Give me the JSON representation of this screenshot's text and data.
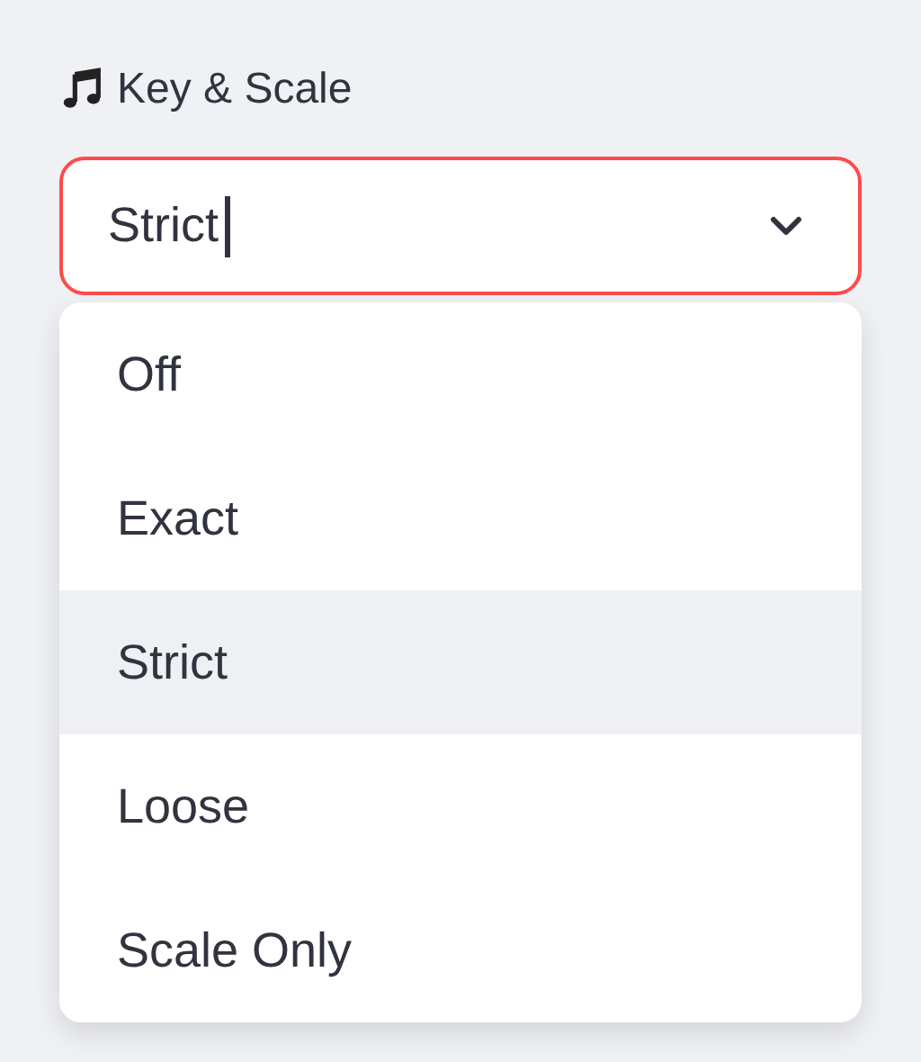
{
  "field": {
    "label": "Key & Scale",
    "value": "Strict",
    "focused": true,
    "expanded": true
  },
  "options": [
    {
      "label": "Off",
      "selected": false
    },
    {
      "label": "Exact",
      "selected": false
    },
    {
      "label": "Strict",
      "selected": true
    },
    {
      "label": "Loose",
      "selected": false
    },
    {
      "label": "Scale Only",
      "selected": false
    }
  ]
}
